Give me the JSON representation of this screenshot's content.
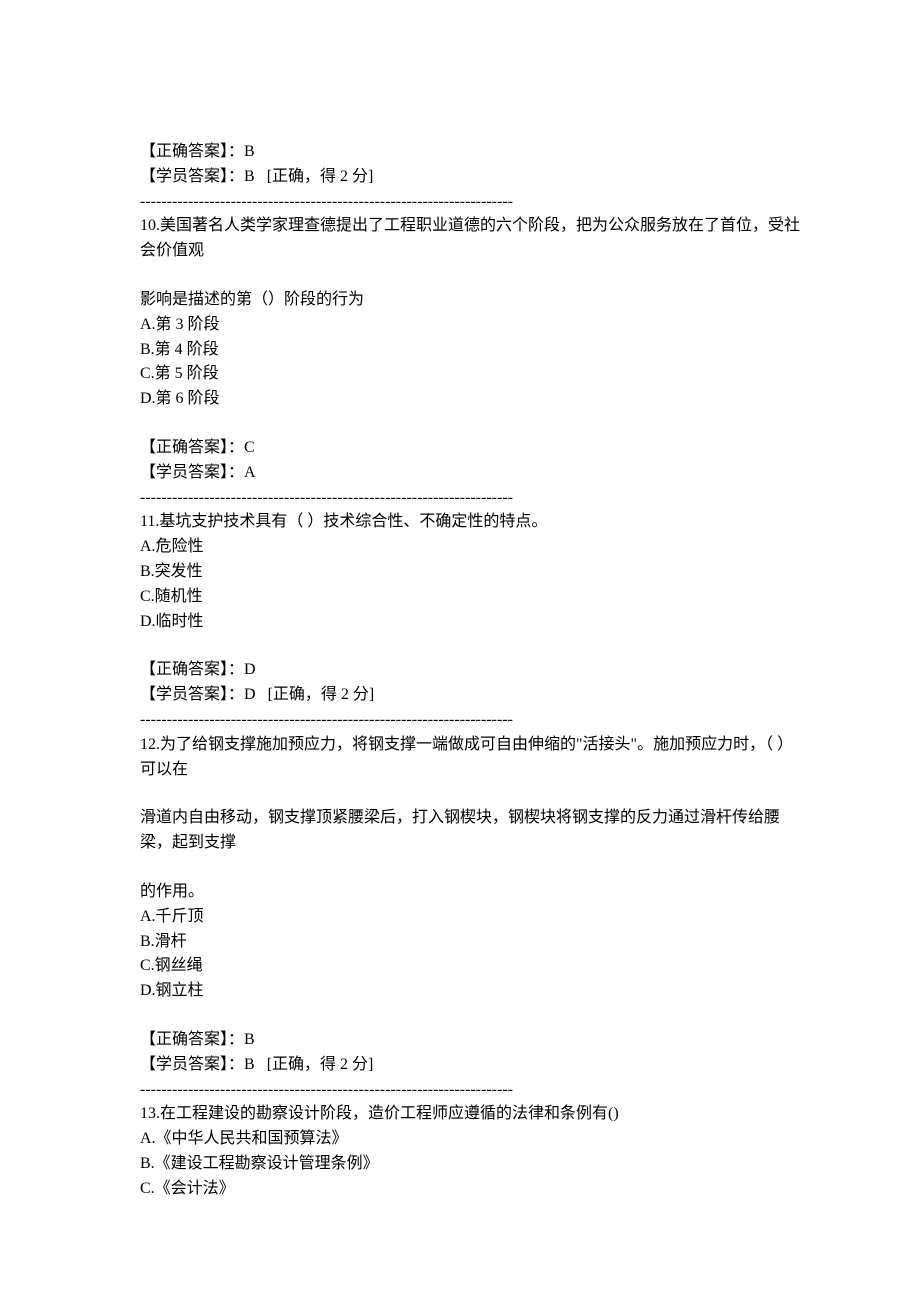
{
  "divider": "----------------------------------------------------------------------",
  "q9": {
    "correct_label": "【正确答案】：",
    "correct_val": "B",
    "student_label": "【学员答案】：",
    "student_val": "B",
    "result": "[正确，得 2 分]"
  },
  "q10": {
    "stem1": "10.美国著名人类学家理查德提出了工程职业道德的六个阶段，把为公众服务放在了首位，受社会价值观",
    "stem2": "影响是描述的第（）阶段的行为",
    "options": {
      "a": "A.第 3 阶段",
      "b": "B.第 4 阶段",
      "c": "C.第 5 阶段",
      "d": "D.第 6 阶段"
    },
    "correct_label": "【正确答案】：",
    "correct_val": "C",
    "student_label": "【学员答案】：",
    "student_val": "A"
  },
  "q11": {
    "stem": "11.基坑支护技术具有（ ）技术综合性、不确定性的特点。",
    "options": {
      "a": "A.危险性",
      "b": "B.突发性",
      "c": "C.随机性",
      "d": "D.临时性"
    },
    "correct_label": "【正确答案】：",
    "correct_val": "D",
    "student_label": "【学员答案】：",
    "student_val": "D",
    "result": "[正确，得 2 分]"
  },
  "q12": {
    "stem1": "12.为了给钢支撑施加预应力，将钢支撑一端做成可自由伸缩的\"活接头\"。施加预应力时，（ ）可以在",
    "stem2": "滑道内自由移动，钢支撑顶紧腰梁后，打入钢楔块，钢楔块将钢支撑的反力通过滑杆传给腰梁，起到支撑",
    "stem3": "的作用。",
    "options": {
      "a": "A.千斤顶",
      "b": "B.滑杆",
      "c": "C.钢丝绳",
      "d": "D.钢立柱"
    },
    "correct_label": "【正确答案】：",
    "correct_val": "B",
    "student_label": "【学员答案】：",
    "student_val": "B",
    "result": "[正确，得 2 分]"
  },
  "q13": {
    "stem": "13.在工程建设的勘察设计阶段，造价工程师应遵循的法律和条例有()",
    "options": {
      "a": "A.《中华人民共和国预算法》",
      "b": "B.《建设工程勘察设计管理条例》",
      "c": "C.《会计法》"
    }
  }
}
